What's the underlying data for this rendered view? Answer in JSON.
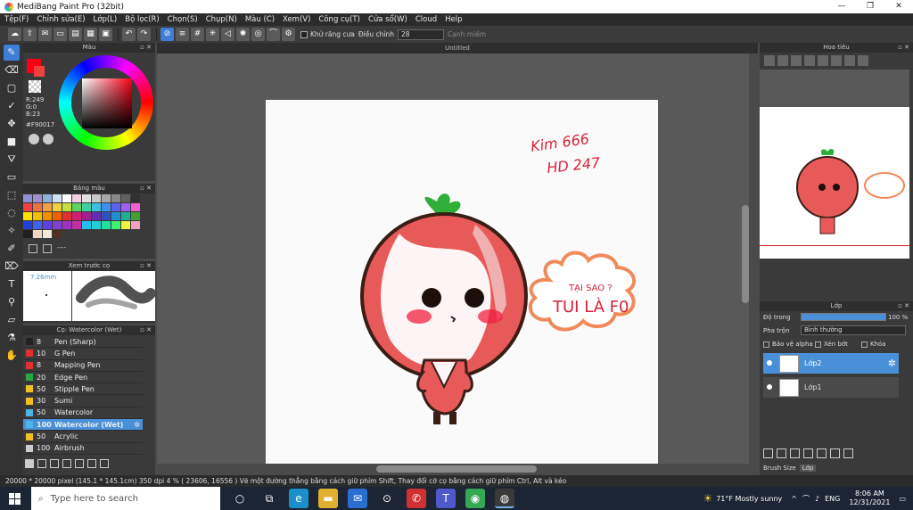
{
  "window": {
    "title": "MediBang Paint Pro (32bit)",
    "min": "—",
    "max": "❐",
    "close": "✕"
  },
  "menu": [
    "Tệp(F)",
    "Chỉnh sửa(E)",
    "Lớp(L)",
    "Bộ lọc(R)",
    "Chọn(S)",
    "Chụp(N)",
    "Màu (C)",
    "Xem(V)",
    "Công cụ(T)",
    "Cửa sổ(W)",
    "Cloud",
    "Help"
  ],
  "toolbar": {
    "antialias_label": "Khử răng cưa",
    "correction_label": "Điều chỉnh",
    "correction_value": "28",
    "snap_label": "Cạnh miếm"
  },
  "color_panel": {
    "title": "Màu",
    "r": "R:249",
    "g": "G:0",
    "b": "B:23",
    "hex": "#F90017",
    "primary": "#f90017",
    "secondary": "#ffffff"
  },
  "palette_panel": {
    "title": "Bảng màu",
    "extra": "----"
  },
  "preview_panel": {
    "title": "Xem trước cọ",
    "size": "7.26mm"
  },
  "brush_panel": {
    "title": "Cọ: Watercolor (Wet)",
    "brushes": [
      {
        "size": "8",
        "name": "Pen (Sharp)",
        "color": "#222222"
      },
      {
        "size": "10",
        "name": "G Pen",
        "color": "#e03030"
      },
      {
        "size": "8",
        "name": "Mapping Pen",
        "color": "#e03030"
      },
      {
        "size": "20",
        "name": "Edge Pen",
        "color": "#28a745"
      },
      {
        "size": "50",
        "name": "Stipple Pen",
        "color": "#f0c020"
      },
      {
        "size": "30",
        "name": "Sumi",
        "color": "#f0c020"
      },
      {
        "size": "50",
        "name": "Watercolor",
        "color": "#4fb3e8"
      },
      {
        "size": "100",
        "name": "Watercolor (Wet)",
        "color": "#4fb3e8",
        "selected": true
      },
      {
        "size": "50",
        "name": "Acrylic",
        "color": "#f0c020"
      },
      {
        "size": "100",
        "name": "Airbrush",
        "color": "#cccccc"
      }
    ]
  },
  "document": {
    "tab": "Untitled"
  },
  "artwork": {
    "text1": "Kim 666",
    "text2": "HD 247",
    "bubble1": "TẠI SAO ?",
    "bubble2": "TUI LÀ F0"
  },
  "navigator_panel": {
    "title": "Hoa tiêu"
  },
  "layer_panel": {
    "title": "Lớp",
    "opacity_label": "Độ trong",
    "opacity_value": "100 %",
    "opacity": 100,
    "blend_label": "Pha trộn",
    "blend_value": "Bình thường",
    "protect_alpha": "Bảo vệ alpha",
    "clip": "Xén bớt",
    "lock": "Khóa",
    "layers": [
      {
        "name": "Lớp2",
        "selected": true
      },
      {
        "name": "Lớp1",
        "selected": false
      }
    ]
  },
  "right_bottom_tabs": [
    "Brush Size",
    "Lớp"
  ],
  "status": "20000 * 20000 pixel   (145.1 * 145.1cm)   350 dpi   4 %   ( 23606, 16556 )   Vẽ một đường thẳng bằng cách giữ phím Shift, Thay đổi cỡ cọ bằng cách giữ phím Ctrl, Alt và kéo",
  "taskbar": {
    "search_placeholder": "Type here to search",
    "weather": "71°F  Mostly sunny",
    "lang": "ENG",
    "time": "8:06 AM",
    "date": "12/31/2021"
  }
}
